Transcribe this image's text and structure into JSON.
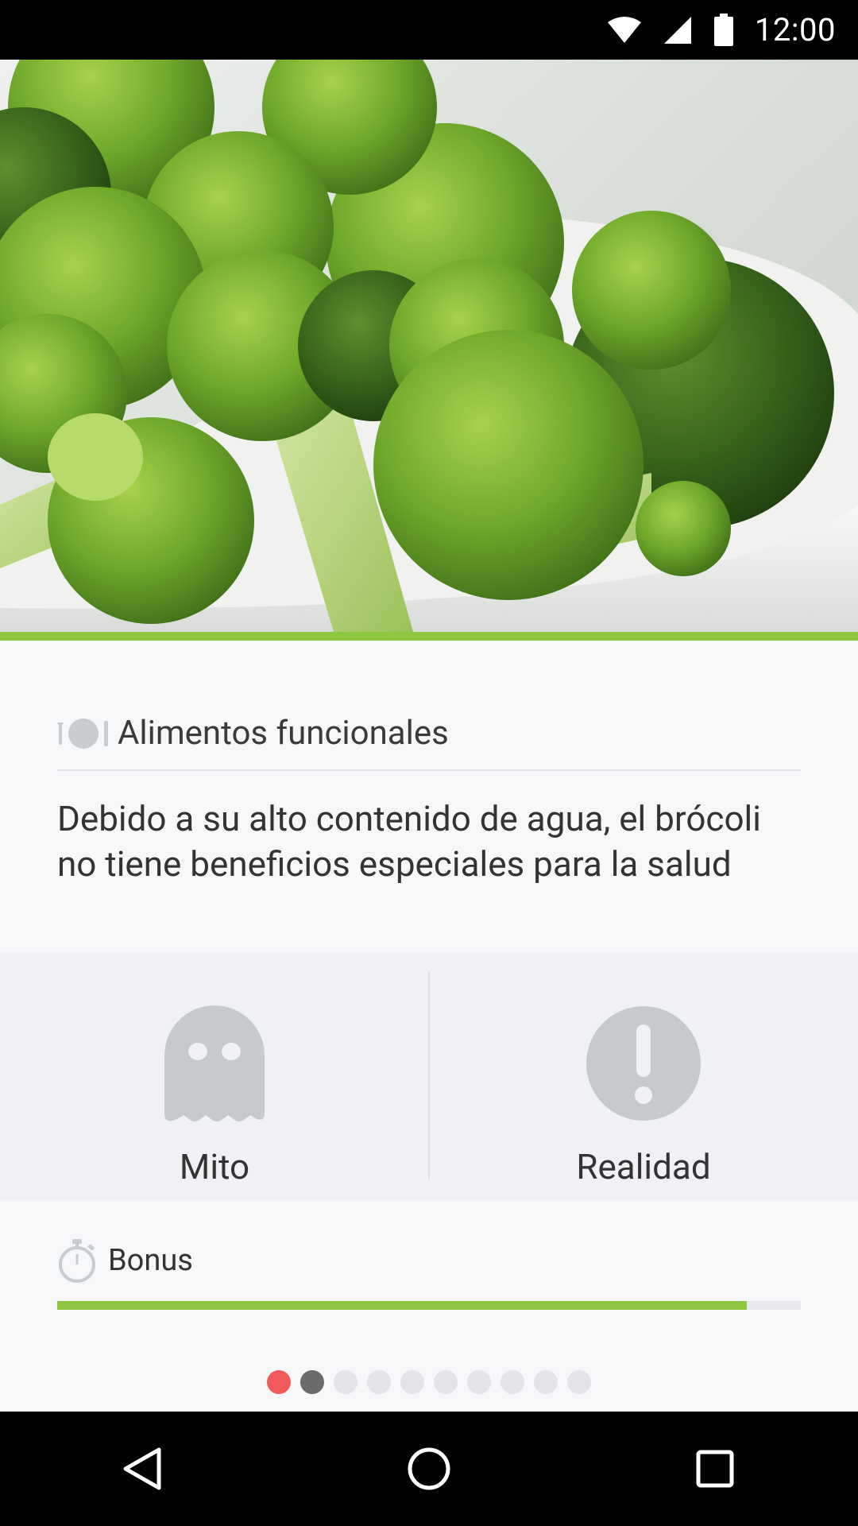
{
  "status_bar": {
    "time": "12:00",
    "icons": [
      "wifi-icon",
      "signal-icon",
      "battery-icon"
    ]
  },
  "hero": {
    "subject": "broccoli-photo",
    "accent_color": "#8dc63f"
  },
  "card": {
    "category_icon": "cutlery-plate-icon",
    "category": "Alimentos funcionales",
    "question": "Debido a su alto contenido de agua, el brócoli no tiene beneficios especiales para la salud"
  },
  "answers": [
    {
      "label": "Mito",
      "icon": "ghost-icon"
    },
    {
      "label": "Realidad",
      "icon": "exclamation-icon"
    }
  ],
  "bonus": {
    "icon": "stopwatch-icon",
    "label": "Bonus",
    "progress": 0.927,
    "bar_color": "#8dc63f"
  },
  "pager": {
    "total": 10,
    "current_index": 0,
    "completed_index": 1,
    "colors": {
      "current": "#f05a5a",
      "completed": "#6b6b6b",
      "pending": "#e2e4e8"
    }
  },
  "nav_bar": [
    "back-icon",
    "home-icon",
    "recents-icon"
  ]
}
